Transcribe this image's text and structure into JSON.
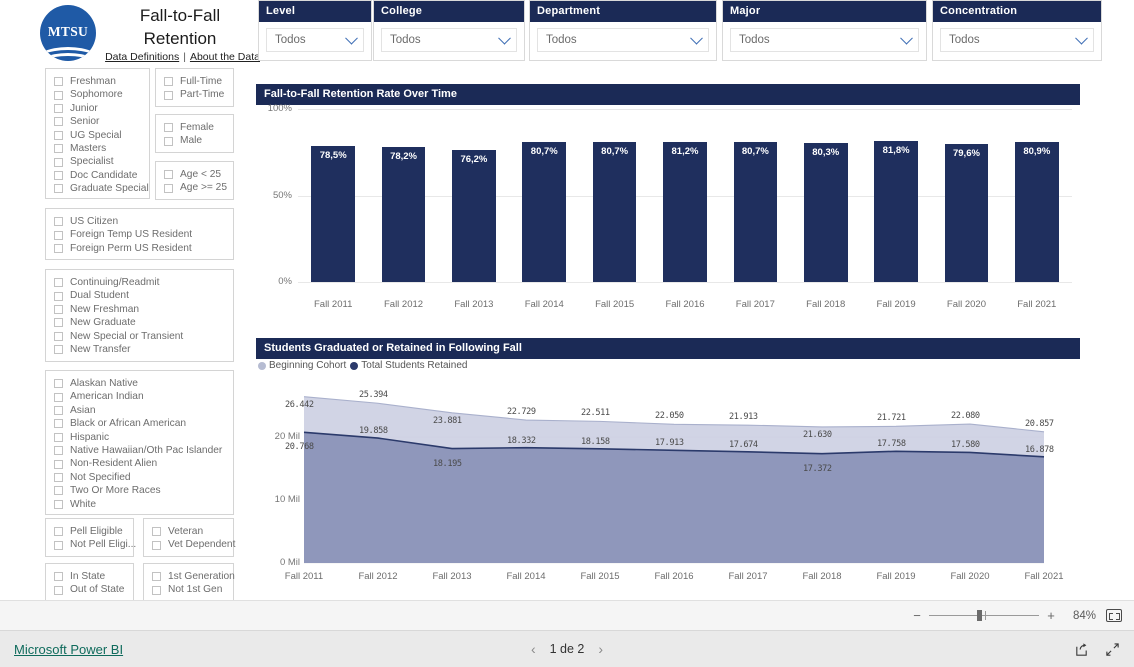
{
  "header": {
    "logo_text": "MTSU",
    "title_line1": "Fall-to-Fall",
    "title_line2": "Retention",
    "link_data_definitions": "Data Definitions",
    "link_separator": "|",
    "link_about": "About the Data"
  },
  "slicers": [
    {
      "name": "Level",
      "value": "Todos"
    },
    {
      "name": "College",
      "value": "Todos"
    },
    {
      "name": "Department",
      "value": "Todos"
    },
    {
      "name": "Major",
      "value": "Todos"
    },
    {
      "name": "Concentration",
      "value": "Todos"
    }
  ],
  "filter_groups": [
    {
      "id": "level",
      "items": [
        "Freshman",
        "Sophomore",
        "Junior",
        "Senior",
        "UG Special",
        "Masters",
        "Specialist",
        "Doc Candidate",
        "Graduate Special"
      ]
    },
    {
      "id": "enrollment",
      "items": [
        "Full-Time",
        "Part-Time"
      ]
    },
    {
      "id": "gender",
      "items": [
        "Female",
        "Male"
      ]
    },
    {
      "id": "age",
      "items": [
        "Age < 25",
        "Age >= 25"
      ]
    },
    {
      "id": "citizenship",
      "items": [
        "US Citizen",
        "Foreign Temp US Resident",
        "Foreign Perm US Resident"
      ]
    },
    {
      "id": "studenttype",
      "items": [
        "Continuing/Readmit",
        "Dual Student",
        "New Freshman",
        "New Graduate",
        "New Special or Transient",
        "New Transfer"
      ]
    },
    {
      "id": "ethnicity",
      "items": [
        "Alaskan Native",
        "American Indian",
        "Asian",
        "Black or African American",
        "Hispanic",
        "Native Hawaiian/Oth Pac Islander",
        "Non-Resident Alien",
        "Not Specified",
        "Two Or More Races",
        "White"
      ]
    },
    {
      "id": "pell",
      "items": [
        "Pell Eligible",
        "Not Pell Eligi..."
      ]
    },
    {
      "id": "veteran",
      "items": [
        "Veteran",
        "Vet Dependent"
      ]
    },
    {
      "id": "residency",
      "items": [
        "In State",
        "Out of State"
      ]
    },
    {
      "id": "generation",
      "items": [
        "1st Generation",
        "Not 1st Gen"
      ]
    }
  ],
  "chart_data": [
    {
      "type": "bar",
      "title": "Fall-to-Fall Retention Rate Over Time",
      "xlabel": "",
      "ylabel": "",
      "ylim": [
        0,
        100
      ],
      "ytick_labels": [
        "100%",
        "50%",
        "0%"
      ],
      "ytick_values": [
        100,
        50,
        0
      ],
      "grid": true,
      "bar_color": "#1f2f5e",
      "label_color": "#ffffff",
      "categories": [
        "Fall 2011",
        "Fall 2012",
        "Fall 2013",
        "Fall 2014",
        "Fall 2015",
        "Fall 2016",
        "Fall 2017",
        "Fall 2018",
        "Fall 2019",
        "Fall 2020",
        "Fall 2021"
      ],
      "values": [
        78.5,
        78.2,
        76.2,
        80.7,
        80.7,
        81.2,
        80.7,
        80.3,
        81.8,
        79.6,
        80.9
      ],
      "value_labels": [
        "78,5%",
        "78,2%",
        "76,2%",
        "80,7%",
        "80,7%",
        "81,2%",
        "80,7%",
        "80,3%",
        "81,8%",
        "79,6%",
        "80,9%"
      ]
    },
    {
      "type": "area",
      "title": "Students Graduated or Retained in Following Fall",
      "xlabel": "",
      "ylabel": "",
      "ylim": [
        0,
        27500
      ],
      "ytick_labels": [
        "20 Mil",
        "10 Mil",
        "0 Mil"
      ],
      "ytick_values": [
        20000,
        10000,
        0
      ],
      "grid": true,
      "legend_position": "top-left",
      "categories": [
        "Fall 2011",
        "Fall 2012",
        "Fall 2013",
        "Fall 2014",
        "Fall 2015",
        "Fall 2016",
        "Fall 2017",
        "Fall 2018",
        "Fall 2019",
        "Fall 2020",
        "Fall 2021"
      ],
      "series": [
        {
          "name": "Beginning Cohort",
          "color": "#c9cde0",
          "values": [
            26442,
            25394,
            23881,
            22729,
            22511,
            22050,
            21913,
            21630,
            21721,
            22080,
            20857
          ],
          "value_labels": [
            "26.442",
            "25.394",
            "23.881",
            "22.729",
            "22.511",
            "22.050",
            "21.913",
            "21.630",
            "21.721",
            "22.080",
            "20.857"
          ]
        },
        {
          "name": "Total Students Retained",
          "color": "#8b93b8",
          "line_color": "#2b3a6b",
          "values": [
            20768,
            19858,
            18195,
            18332,
            18158,
            17913,
            17674,
            17372,
            17758,
            17580,
            16878
          ],
          "value_labels": [
            "20.768",
            "19.858",
            "18.195",
            "18.332",
            "18.158",
            "17.913",
            "17.674",
            "17.372",
            "17.758",
            "17.580",
            "16.878"
          ]
        }
      ]
    }
  ],
  "statusbar": {
    "zoom_out": "−",
    "zoom_in": "+",
    "zoom_level": "84%",
    "fit_icon": "fit-to-page-icon"
  },
  "footer": {
    "brand": "Microsoft Power BI",
    "prev_arrow": "‹",
    "page_text": "1 de 2",
    "next_arrow": "›",
    "share_icon": "share-icon",
    "fullscreen_icon": "fullscreen-icon"
  }
}
